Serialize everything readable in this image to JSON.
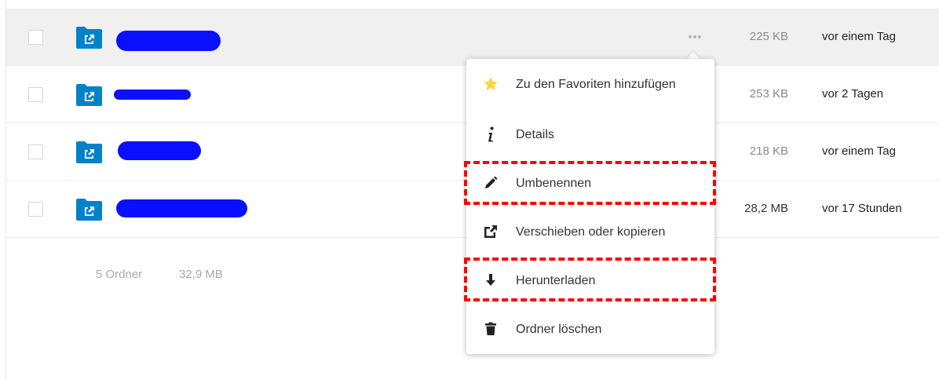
{
  "files": [
    {
      "size": "225 KB",
      "modified": "vor einem Tag"
    },
    {
      "size": "253 KB",
      "modified": "vor 2 Tagen"
    },
    {
      "size": "218 KB",
      "modified": "vor einem Tag"
    },
    {
      "size": "28,2 MB",
      "modified": "vor 17 Stunden"
    }
  ],
  "summary": {
    "folders": "5 Ordner",
    "total_size": "32,9 MB"
  },
  "menu": {
    "items": [
      {
        "label": "Zu den Favoriten hinzufügen",
        "icon": "star-icon"
      },
      {
        "label": "Details",
        "icon": "info-icon"
      },
      {
        "label": "Umbenennen",
        "icon": "pencil-icon"
      },
      {
        "label": "Verschieben oder kopieren",
        "icon": "external-link-icon"
      },
      {
        "label": "Herunterladen",
        "icon": "download-icon"
      },
      {
        "label": "Ordner löschen",
        "icon": "trash-icon"
      }
    ]
  },
  "colors": {
    "folder": "#0082c9",
    "star": "#fdd733",
    "redaction": "#0a10ff",
    "annotation": "#ff0000"
  }
}
